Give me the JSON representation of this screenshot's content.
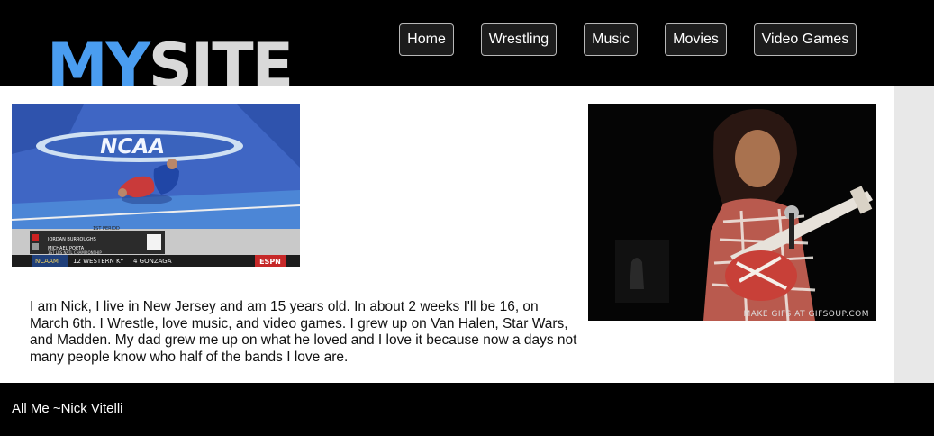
{
  "header": {
    "logo": {
      "part1": "MY",
      "part2": "SITE"
    },
    "nav": [
      {
        "label": "Home"
      },
      {
        "label": "Wrestling"
      },
      {
        "label": "Music"
      },
      {
        "label": "Movies"
      },
      {
        "label": "Video Games"
      }
    ]
  },
  "main": {
    "wrestling_gif": {
      "logo_text": "NCAA",
      "scoreboard_line1": "JORDAN BURROUGHS",
      "scoreboard_line2": "MICHAEL POETA",
      "period": "1ST PERIOD",
      "championship": "1ST LBS NATL CHAMPIONSHIP",
      "ticker_left": "NCAAM",
      "ticker_mid": "12 WESTERN KY",
      "ticker_right": "4 GONZAGA",
      "network": "ESPN"
    },
    "music_gif": {
      "caption": "MAKE GIFS AT GIFSOUP.COM"
    },
    "bio": "I am Nick, I live in New Jersey and am 15 years old. In about 2 weeks I'll be 16, on March 6th. I Wrestle, love music, and video games. I grew up on Van Halen, Star Wars, and Madden. My dad grew me up on what he loved and I love it because now a days not many people know who half of the bands I love are."
  },
  "footer": {
    "text": "All Me ~Nick Vitelli"
  },
  "colors": {
    "logo_my": "#4a9df0",
    "logo_site": "#d9d9d9",
    "header_bg": "#000000"
  }
}
